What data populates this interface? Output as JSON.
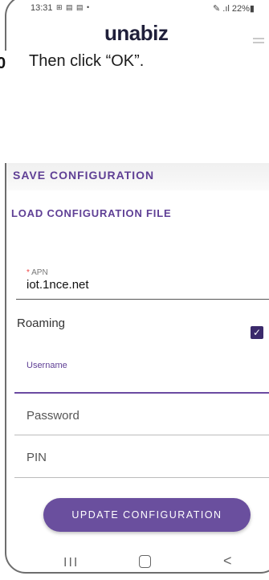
{
  "status_bar": {
    "time": "13:31",
    "icons": "⊞ ▤ ▤ •",
    "right": "✎ .ıl 22%▮"
  },
  "app": {
    "logo": "unabiz"
  },
  "instruction": {
    "step": "0",
    "text": "Then click “OK”."
  },
  "actions": {
    "save": "SAVE CONFIGURATION",
    "load": "LOAD CONFIGURATION FILE"
  },
  "form": {
    "apn": {
      "required_mark": "*",
      "label": "APN",
      "value": "iot.1nce.net"
    },
    "roaming": {
      "label": "Roaming",
      "checked": true
    },
    "username": {
      "placeholder": "Username"
    },
    "password": {
      "placeholder": "Password"
    },
    "pin": {
      "placeholder": "PIN"
    }
  },
  "update_button": "UPDATE CONFIGURATION",
  "nav": {
    "recent": "III",
    "back": "<"
  },
  "colors": {
    "accent": "#6a4f9e",
    "link": "#5f3f95",
    "checkbox": "#3b2a6b"
  }
}
